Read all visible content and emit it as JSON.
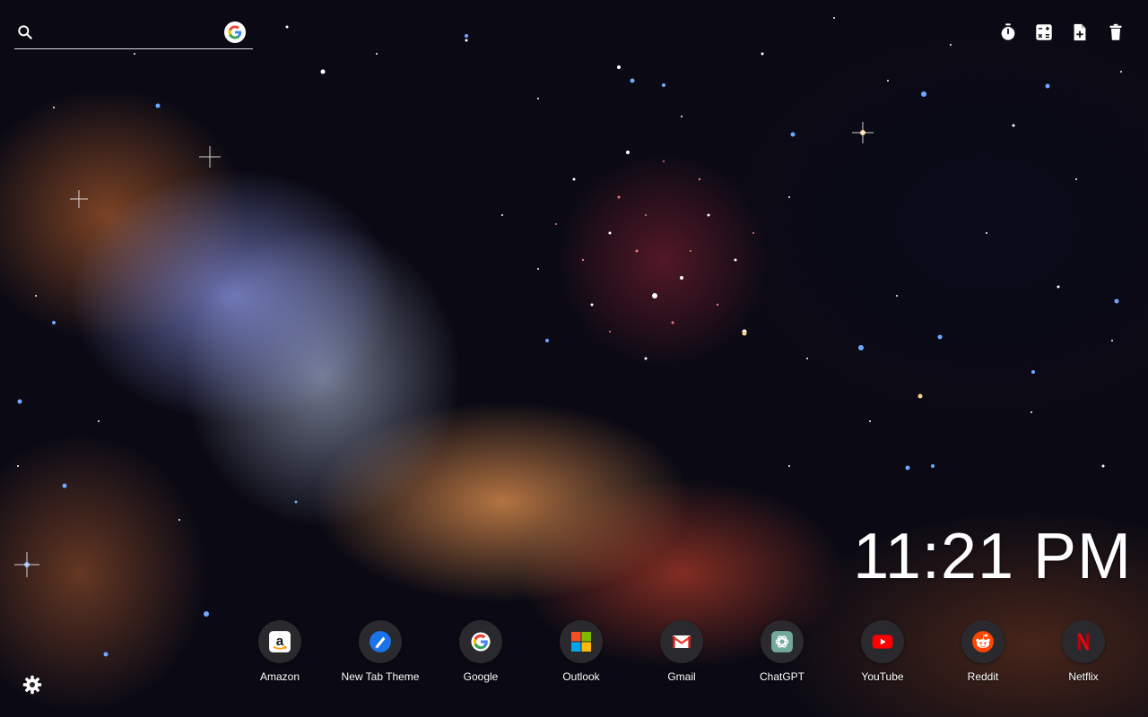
{
  "search": {
    "placeholder": "",
    "value": "",
    "engine_icon": "google-icon"
  },
  "toolbar": {
    "tools": [
      {
        "name": "timer-icon"
      },
      {
        "name": "calculator-icon"
      },
      {
        "name": "new-note-icon"
      },
      {
        "name": "trash-icon"
      }
    ]
  },
  "clock": {
    "time": "11:21 PM"
  },
  "settings": {
    "icon": "gear-icon"
  },
  "shortcuts": [
    {
      "label": "Amazon",
      "icon": "amazon-icon"
    },
    {
      "label": "New Tab Theme",
      "icon": "new-tab-theme-icon"
    },
    {
      "label": "Google",
      "icon": "google-icon"
    },
    {
      "label": "Outlook",
      "icon": "microsoft-icon"
    },
    {
      "label": "Gmail",
      "icon": "gmail-icon"
    },
    {
      "label": "ChatGPT",
      "icon": "chatgpt-icon"
    },
    {
      "label": "YouTube",
      "icon": "youtube-icon"
    },
    {
      "label": "Reddit",
      "icon": "reddit-icon"
    },
    {
      "label": "Netflix",
      "icon": "netflix-icon"
    }
  ],
  "colors": {
    "text": "#ffffff",
    "shortcut_bg": "#2a2a2e"
  }
}
